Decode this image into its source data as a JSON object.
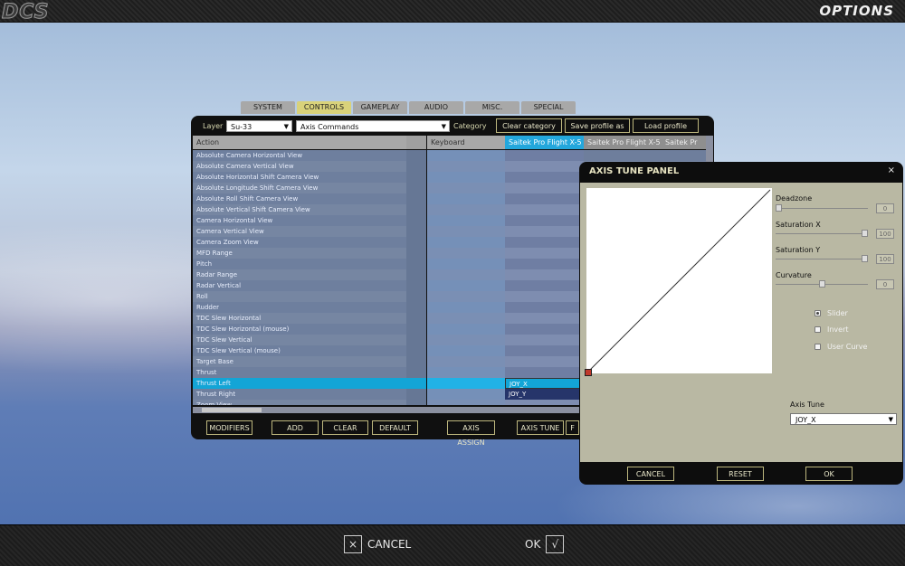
{
  "app": {
    "logo": "DCS",
    "title": "OPTIONS"
  },
  "tabs": [
    {
      "label": "SYSTEM",
      "active": false
    },
    {
      "label": "CONTROLS",
      "active": true
    },
    {
      "label": "GAMEPLAY",
      "active": false
    },
    {
      "label": "AUDIO",
      "active": false
    },
    {
      "label": "MISC.",
      "active": false
    },
    {
      "label": "SPECIAL",
      "active": false
    }
  ],
  "toolbar": {
    "layer_label": "Layer",
    "layer_value": "Su-33",
    "category_value": "Axis Commands",
    "category_label": "Category",
    "clear_category": "Clear category",
    "save_profile": "Save profile as",
    "load_profile": "Load profile"
  },
  "columns": {
    "action": "Action",
    "keyboard": "Keyboard",
    "device1": "Saitek Pro Flight X-5",
    "device2": "Saitek Pro Flight X-5",
    "device3": "Saitek Pr"
  },
  "rows": [
    {
      "action": "Absolute Camera Horizontal View",
      "dev1": ""
    },
    {
      "action": "Absolute Camera Vertical View",
      "dev1": ""
    },
    {
      "action": "Absolute Horizontal Shift Camera View",
      "dev1": ""
    },
    {
      "action": "Absolute Longitude Shift Camera View",
      "dev1": ""
    },
    {
      "action": "Absolute Roll Shift Camera View",
      "dev1": ""
    },
    {
      "action": "Absolute Vertical Shift Camera View",
      "dev1": ""
    },
    {
      "action": "Camera Horizontal View",
      "dev1": ""
    },
    {
      "action": "Camera Vertical View",
      "dev1": ""
    },
    {
      "action": "Camera Zoom View",
      "dev1": ""
    },
    {
      "action": "MFD Range",
      "dev1": ""
    },
    {
      "action": "Pitch",
      "dev1": ""
    },
    {
      "action": "Radar Range",
      "dev1": ""
    },
    {
      "action": "Radar Vertical",
      "dev1": ""
    },
    {
      "action": "Roll",
      "dev1": ""
    },
    {
      "action": "Rudder",
      "dev1": ""
    },
    {
      "action": "TDC Slew Horizontal",
      "dev1": ""
    },
    {
      "action": "TDC Slew Horizontal (mouse)",
      "dev1": ""
    },
    {
      "action": "TDC Slew Vertical",
      "dev1": ""
    },
    {
      "action": "TDC Slew Vertical (mouse)",
      "dev1": ""
    },
    {
      "action": "Target Base",
      "dev1": ""
    },
    {
      "action": "Thrust",
      "dev1": ""
    },
    {
      "action": "Thrust Left",
      "dev1": "JOY_X",
      "selected": true
    },
    {
      "action": "Thrust Right",
      "dev1": "JOY_Y"
    },
    {
      "action": "Zoom View",
      "dev1": ""
    }
  ],
  "panel_buttons": {
    "modifiers": "MODIFIERS",
    "add": "ADD",
    "clear": "CLEAR",
    "default": "DEFAULT",
    "axis_assign": "AXIS ASSIGN",
    "axis_tune": "AXIS TUNE",
    "more": "F"
  },
  "axis_tune": {
    "title": "AXIS TUNE PANEL",
    "close": "×",
    "deadzone_label": "Deadzone",
    "deadzone_value": "0",
    "deadzone_level": 0,
    "satx_label": "Saturation X",
    "satx_value": "100",
    "satx_level": 100,
    "saty_label": "Saturation Y",
    "saty_value": "100",
    "saty_level": 100,
    "curvature_label": "Curvature",
    "curvature_value": "0",
    "curvature_level": 50,
    "opt_slider": "Slider",
    "opt_invert": "Invert",
    "opt_user_curve": "User Curve",
    "axis_tune_label": "Axis Tune",
    "axis_tune_value": "JOY_X",
    "cancel": "CANCEL",
    "reset": "RESET",
    "ok": "OK"
  },
  "bottom": {
    "cancel": "CANCEL",
    "cancel_icon": "×",
    "ok": "OK",
    "ok_icon": "√"
  }
}
